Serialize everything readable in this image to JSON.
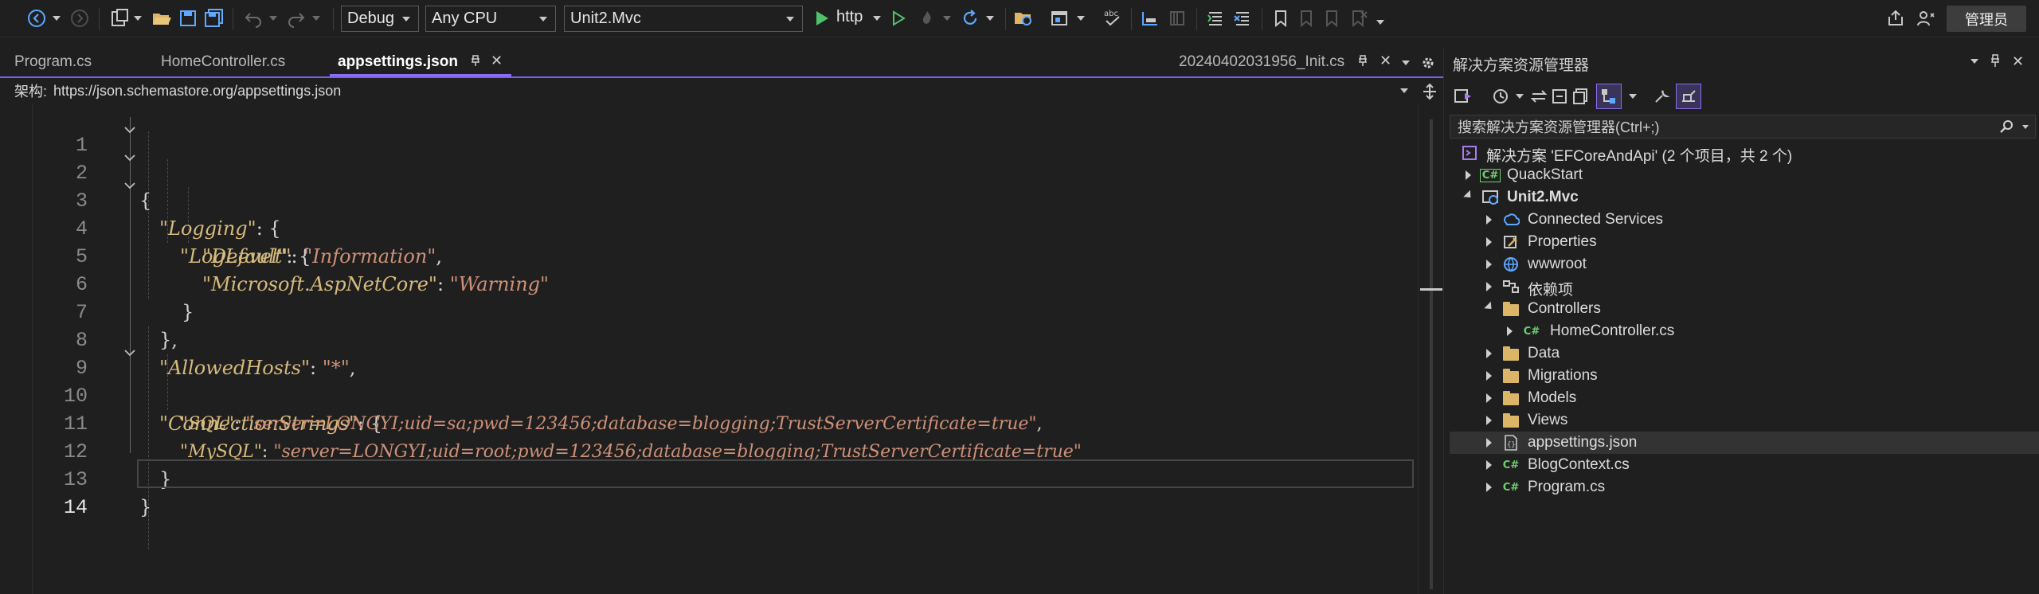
{
  "toolbar": {
    "config": "Debug",
    "platform": "Any CPU",
    "startup_project": "Unit2.Mvc",
    "run_profile": "http",
    "admin_button": "管理员"
  },
  "tabs": [
    {
      "label": "Program.cs",
      "active": false
    },
    {
      "label": "HomeController.cs",
      "active": false
    },
    {
      "label": "appsettings.json",
      "active": true
    },
    {
      "label": "20240402031956_Init.cs",
      "active": false
    }
  ],
  "schema_bar": {
    "label": "架构:",
    "url": "https://json.schemastore.org/appsettings.json"
  },
  "editor": {
    "line_numbers": [
      "1",
      "2",
      "3",
      "4",
      "5",
      "6",
      "7",
      "8",
      "9",
      "10",
      "11",
      "12",
      "13",
      "14"
    ],
    "current_line": 14,
    "lines": [
      {
        "key": "",
        "sep": "{",
        "value": "",
        "tail": ""
      },
      {
        "key": "\"Logging\"",
        "sep": ": {",
        "value": "",
        "tail": ""
      },
      {
        "key": "\"LogLevel\"",
        "sep": ": {",
        "value": "",
        "tail": ""
      },
      {
        "key": "\"Default\"",
        "sep": ": ",
        "value": "\"Information\"",
        "tail": ","
      },
      {
        "key": "\"Microsoft.AspNetCore\"",
        "sep": ": ",
        "value": "\"Warning\"",
        "tail": ""
      },
      {
        "key": "",
        "sep": "}",
        "value": "",
        "tail": ""
      },
      {
        "key": "",
        "sep": "},",
        "value": "",
        "tail": ""
      },
      {
        "key": "\"AllowedHosts\"",
        "sep": ": ",
        "value": "\"*\"",
        "tail": ","
      },
      {
        "key": "\"ConnectionStrings\"",
        "sep": ": {",
        "value": "",
        "tail": ""
      },
      {
        "key": "\"SQL\"",
        "sep": ": ",
        "value": "\"server=LONGYI;uid=sa;pwd=123456;database=blogging;TrustServerCertificate=true\"",
        "tail": ","
      },
      {
        "key": "\"MySQL\"",
        "sep": ": ",
        "value": "\"server=LONGYI;uid=root;pwd=123456;database=blogging;TrustServerCertificate=true\"",
        "tail": ""
      },
      {
        "key": "",
        "sep": "}",
        "value": "",
        "tail": ""
      },
      {
        "key": "",
        "sep": "}",
        "value": "",
        "tail": ""
      },
      {
        "key": "",
        "sep": "",
        "value": "",
        "tail": ""
      }
    ]
  },
  "solution_explorer": {
    "title": "解决方案资源管理器",
    "search_placeholder": "搜索解决方案资源管理器(Ctrl+;)",
    "solution": "解决方案 'EFCoreAndApi' (2 个项目，共 2 个)",
    "items": [
      {
        "label": "QuackStart",
        "icon": "csharp-project-icon"
      },
      {
        "label": "Unit2.Mvc",
        "icon": "web-project-icon"
      },
      {
        "label": "Connected Services",
        "icon": "connected-services-icon"
      },
      {
        "label": "Properties",
        "icon": "properties-icon"
      },
      {
        "label": "wwwroot",
        "icon": "globe-icon"
      },
      {
        "label": "依赖项",
        "icon": "dependencies-icon"
      },
      {
        "label": "Controllers",
        "icon": "folder-icon"
      },
      {
        "label": "HomeController.cs",
        "icon": "csharp-file-icon"
      },
      {
        "label": "Data",
        "icon": "folder-icon"
      },
      {
        "label": "Migrations",
        "icon": "folder-icon"
      },
      {
        "label": "Models",
        "icon": "folder-icon"
      },
      {
        "label": "Views",
        "icon": "folder-icon"
      },
      {
        "label": "appsettings.json",
        "icon": "json-file-icon"
      },
      {
        "label": "BlogContext.cs",
        "icon": "csharp-file-icon"
      },
      {
        "label": "Program.cs",
        "icon": "csharp-file-icon"
      }
    ]
  },
  "colors": {
    "accent": "#8c6cf0",
    "json_key": "#d7ba7d",
    "json_string": "#ce9178",
    "background": "#1f1f1f"
  }
}
